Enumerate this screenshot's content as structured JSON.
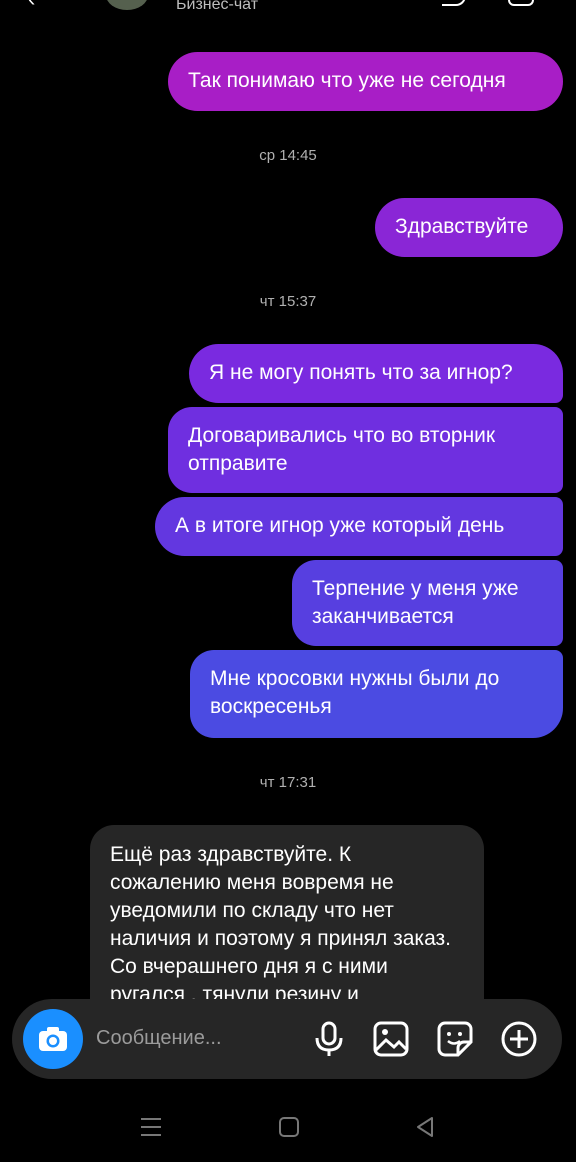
{
  "header": {
    "subtitle": "Бизнес-чат"
  },
  "messages": [
    {
      "text": "Так понимаю что уже не сегодня"
    },
    {
      "text": "Здравствуйте"
    },
    {
      "text": "Я не могу понять что за игнор?"
    },
    {
      "text": "Договаривались что во вторник отправите"
    },
    {
      "text": "А в итоге игнор уже который день"
    },
    {
      "text": "Терпение у меня уже заканчивается"
    },
    {
      "text": "Мне кросовки нужны были до воскресенья"
    }
  ],
  "timestamps": [
    "ср 14:45",
    "чт 15:37",
    "чт 17:31"
  ],
  "incoming": {
    "text": "Ещё раз  здравствуйте. К сожалению меня вовремя не уведомили по складу что нет наличия  и поэтому я принял заказ. Со вчерашнего дня я с ними ругался , тянули резину и"
  },
  "composer": {
    "placeholder": "Сообщение...",
    "icons": [
      "camera-icon",
      "microphone-icon",
      "gallery-icon",
      "sticker-icon",
      "plus-icon"
    ]
  },
  "navbar": {
    "icons": [
      "menu-icon",
      "home-icon",
      "back-icon"
    ]
  },
  "colors": {
    "bubble_magenta": "#a51fc4",
    "bubble_purple": "#7b2be0",
    "bubble_blue": "#4a4fe0",
    "camera_blue": "#1a8fff"
  }
}
